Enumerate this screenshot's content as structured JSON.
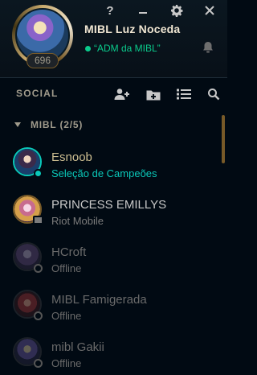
{
  "window": {
    "help_label": "?",
    "minimize_label": "–",
    "settings_icon": "gear-icon",
    "close_label": "✕"
  },
  "profile": {
    "summoner_name": "MIBL Luz Noceda",
    "status_message": "“ADM da MIBL”",
    "level": "696",
    "status_color": "#0acb8c"
  },
  "social": {
    "title": "SOCIAL",
    "icons": [
      "add-friend-icon",
      "add-folder-icon",
      "list-sort-icon",
      "search-icon"
    ]
  },
  "group": {
    "label": "MIBL (2/5)"
  },
  "friends": [
    {
      "name": "Esnoob",
      "status": "Seleção de Campeões",
      "state": "in-champ-select"
    },
    {
      "name": "PRINCESS EMILLYS",
      "status": "Riot Mobile",
      "state": "mobile"
    },
    {
      "name": "HCroft",
      "status": "Offline",
      "state": "offline"
    },
    {
      "name": "MIBL Famigerada",
      "status": "Offline",
      "state": "offline"
    },
    {
      "name": "mibl Gakii",
      "status": "Offline",
      "state": "offline"
    }
  ],
  "colors": {
    "accent_gold": "#c8aa6e",
    "champ_select": "#0ac8b9",
    "online_green": "#0acb8c",
    "background": "#010a13"
  }
}
